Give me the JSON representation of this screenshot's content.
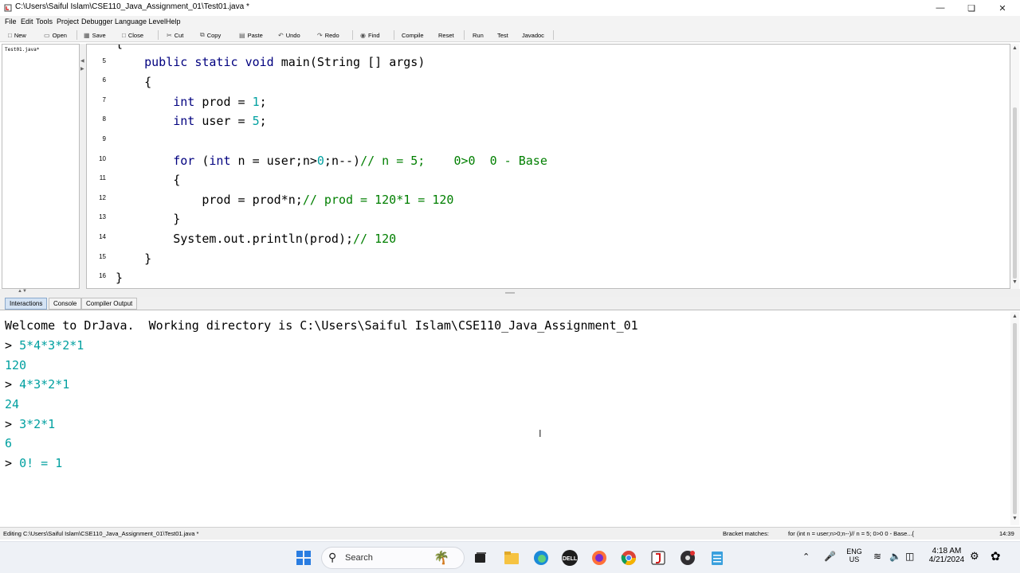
{
  "window": {
    "title": "C:\\Users\\Saiful Islam\\CSE110_Java_Assignment_01\\Test01.java *",
    "controls": [
      "minimize",
      "maximize",
      "close"
    ]
  },
  "menu": [
    "File",
    "Edit",
    "Tools",
    "Project",
    "Debugger",
    "Language Level",
    "Help"
  ],
  "toolbar": {
    "new": "New",
    "open": "Open",
    "save": "Save",
    "close": "Close",
    "cut": "Cut",
    "copy": "Copy",
    "paste": "Paste",
    "undo": "Undo",
    "redo": "Redo",
    "find": "Find",
    "compile": "Compile",
    "reset": "Reset",
    "run": "Run",
    "test": "Test",
    "javadoc": "Javadoc"
  },
  "files": [
    "Test01.java*"
  ],
  "editor": {
    "lines": [
      {
        "num": "",
        "text": "{"
      },
      {
        "num": "5",
        "text": "    public static void main(String [] args)"
      },
      {
        "num": "6",
        "text": "    {"
      },
      {
        "num": "7",
        "text": "        int prod = 1;"
      },
      {
        "num": "8",
        "text": "        int user = 5;"
      },
      {
        "num": "9",
        "text": ""
      },
      {
        "num": "10",
        "text": "        for (int n = user;n>0;n--)// n = 5;    0>0  0 - Base"
      },
      {
        "num": "11",
        "text": "        {"
      },
      {
        "num": "12",
        "text": "            prod = prod*n;// prod = 120*1 = 120"
      },
      {
        "num": "13",
        "text": "        }"
      },
      {
        "num": "14",
        "text": "        System.out.println(prod);// 120"
      },
      {
        "num": "15",
        "text": "    }"
      },
      {
        "num": "16",
        "text": "}"
      }
    ]
  },
  "tabs": [
    "Interactions",
    "Console",
    "Compiler Output"
  ],
  "interactions": {
    "welcome": "Welcome to DrJava.  Working directory is C:\\Users\\Saiful Islam\\CSE110_Java_Assignment_01",
    "prompt": ">",
    "entries": [
      {
        "input": "5*4*3*2*1",
        "output": "120"
      },
      {
        "input": "4*3*2*1",
        "output": "24"
      },
      {
        "input": "3*2*1",
        "output": "6"
      },
      {
        "input": "0! = 1",
        "output": ""
      }
    ]
  },
  "status": {
    "editing": "Editing C:\\Users\\Saiful Islam\\CSE110_Java_Assignment_01\\Test01.java *",
    "bracket_label": "Bracket matches:",
    "bracket_text": "for (int n = user;n>0;n--)// n = 5;    0>0  0 - Base...{",
    "position": "14:39"
  },
  "taskbar": {
    "search_placeholder": "Search",
    "language": "ENG",
    "region": "US",
    "time": "4:18 AM",
    "date": "4/21/2024",
    "icons": [
      "windows-start-icon",
      "search-icon",
      "widgets-icon",
      "task-view-icon",
      "file-explorer-icon",
      "edge-icon",
      "dell-icon",
      "firefox-icon",
      "chrome-icon",
      "drjava-icon",
      "obs-icon",
      "notepad-icon"
    ]
  },
  "colors": {
    "keyword": "#00007f",
    "number": "#00a0a0",
    "comment": "#007f00",
    "active_tab": "#d4e3f4"
  }
}
